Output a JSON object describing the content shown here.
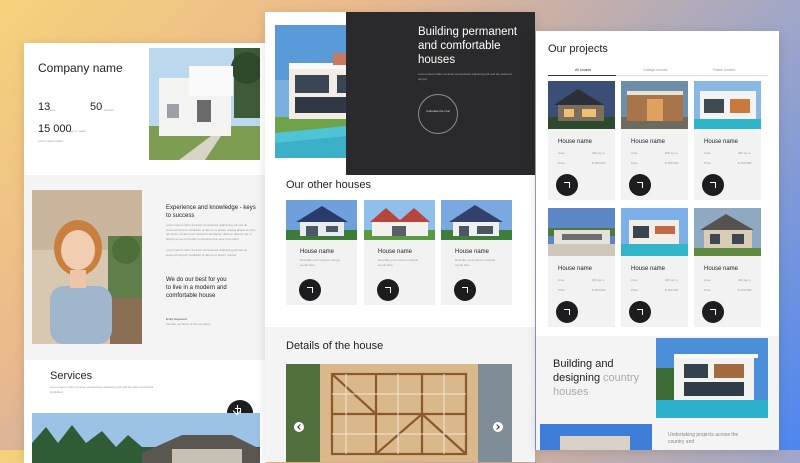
{
  "left": {
    "company_name": "Company name",
    "stats": [
      {
        "value": "13",
        "label": "years"
      },
      {
        "value": "50",
        "label": "houses"
      },
      {
        "value": "15 000",
        "label": "sq.m. made"
      }
    ],
    "stats_note": "Lorem ipsum dolor",
    "experience_title": "Experience and knowledge - keys to success",
    "experience_text": "Lorem ipsum dolor sit amet consectetur adipiscing elit sed do eiusmod tempor incididunt ut labore et dolore magna aliqua ut enim ad minim veniam quis nostrud exercitation ullamco laboris nisi ut aliquip ex ea commodo consequat duis aute irure dolor",
    "experience_text2": "Lorem ipsum dolor sit amet consectetur adipiscing elit sed do eiusmod tempor incididunt ut labore et dolore magna",
    "quote": "We do our best for you to live in a modern and comfortable house",
    "signature_name": "Emily Haywood",
    "signature_role": "founder, architect of the company",
    "services_title": "Services",
    "services_text": "Lorem ipsum dolor sit amet consectetur adipiscing elit sed do eiusmod tempor incididunt"
  },
  "center": {
    "hero_title": "Building permanent and comfortable houses",
    "hero_text": "Lorem ipsum dolor sit amet consectetur adipiscing elit sed do eiusmod tempor",
    "circle_label": "Calculate the cost",
    "other_title": "Our other houses",
    "houses": [
      {
        "name": "House name",
        "desc": "Describe your house in simple words here"
      },
      {
        "name": "House name",
        "desc": "Describe your house in simple words here"
      },
      {
        "name": "House name",
        "desc": "Describe your house in simple words here"
      }
    ],
    "details_title": "Details of the house"
  },
  "right": {
    "projects_title": "Our projects",
    "tabs": [
      "All houses",
      "Cottage houses",
      "Frame houses"
    ],
    "projects": [
      {
        "name": "House name",
        "area_label": "Area",
        "area": "200 sq.m",
        "price_label": "Price",
        "price": "$ 450 000"
      },
      {
        "name": "House name",
        "area_label": "Area",
        "area": "200 sq.m",
        "price_label": "Price",
        "price": "$ 450 000"
      },
      {
        "name": "House name",
        "area_label": "Area",
        "area": "200 sq.m",
        "price_label": "Price",
        "price": "$ 450 000"
      },
      {
        "name": "House name",
        "area_label": "Area",
        "area": "200 sq.m",
        "price_label": "Price",
        "price": "$ 450 000"
      },
      {
        "name": "House name",
        "area_label": "Area",
        "area": "200 sq.m",
        "price_label": "Price",
        "price": "$ 450 000"
      },
      {
        "name": "House name",
        "area_label": "Area",
        "area": "200 sq.m",
        "price_label": "Price",
        "price": "$ 450 000"
      }
    ],
    "building_line1": "Building and",
    "building_line2_dark": "designing",
    "building_line2_light": "country",
    "building_line3": "houses",
    "undertaking_text": "Undertaking projects across the country and"
  },
  "colors": {
    "dark": "#1d1d1f",
    "card": "#f2f2f2",
    "muted": "#999999"
  }
}
